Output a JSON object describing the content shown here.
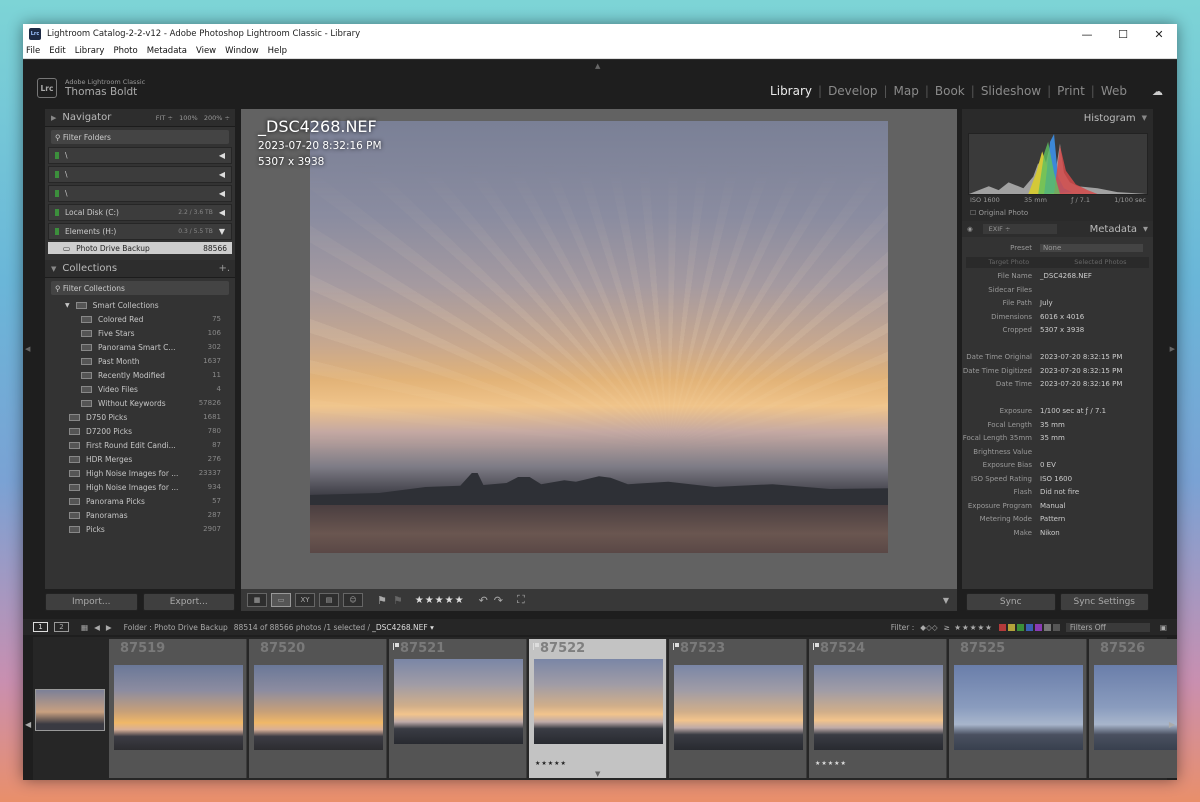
{
  "window": {
    "title": "Lightroom Catalog-2-2-v12 - Adobe Photoshop Lightroom Classic - Library",
    "app_icon": "Lrc"
  },
  "menu": [
    "File",
    "Edit",
    "Library",
    "Photo",
    "Metadata",
    "View",
    "Window",
    "Help"
  ],
  "identity": {
    "logo": "Lrc",
    "product": "Adobe Lightroom Classic",
    "user": "Thomas Boldt"
  },
  "modules": [
    "Library",
    "Develop",
    "Map",
    "Book",
    "Slideshow",
    "Print",
    "Web"
  ],
  "navigator": {
    "title": "Navigator",
    "zooms": [
      "FIT ÷",
      "100%",
      "200% ÷"
    ]
  },
  "folders": {
    "filter": "Filter Folders",
    "volumes": [
      {
        "name": "\\",
        "cap": ""
      },
      {
        "name": "\\",
        "cap": ""
      },
      {
        "name": "\\",
        "cap": ""
      },
      {
        "name": "Local Disk (C:)",
        "cap": "2.2 / 3.6 TB"
      },
      {
        "name": "Elements (H:)",
        "cap": "0.3 / 5.5 TB"
      }
    ],
    "selected": {
      "name": "Photo Drive Backup",
      "count": "88566"
    }
  },
  "collections": {
    "title": "Collections",
    "filter": "Filter Collections",
    "smart": "Smart Collections",
    "items": [
      {
        "name": "Colored Red",
        "count": "75",
        "indent": 2
      },
      {
        "name": "Five Stars",
        "count": "106",
        "indent": 2
      },
      {
        "name": "Panorama Smart C...",
        "count": "302",
        "indent": 2
      },
      {
        "name": "Past Month",
        "count": "1637",
        "indent": 2
      },
      {
        "name": "Recently Modified",
        "count": "11",
        "indent": 2
      },
      {
        "name": "Video Files",
        "count": "4",
        "indent": 2
      },
      {
        "name": "Without Keywords",
        "count": "57826",
        "indent": 2
      },
      {
        "name": "D750 Picks",
        "count": "1681",
        "indent": 1
      },
      {
        "name": "D7200 Picks",
        "count": "780",
        "indent": 1
      },
      {
        "name": "First Round Edit Candi...",
        "count": "87",
        "indent": 1
      },
      {
        "name": "HDR Merges",
        "count": "276",
        "indent": 1
      },
      {
        "name": "High Noise Images for ...",
        "count": "23337",
        "indent": 1
      },
      {
        "name": "High Noise Images for ...",
        "count": "934",
        "indent": 1
      },
      {
        "name": "Panorama Picks",
        "count": "57",
        "indent": 1
      },
      {
        "name": "Panoramas",
        "count": "287",
        "indent": 1
      },
      {
        "name": "Picks",
        "count": "2907",
        "indent": 1
      }
    ]
  },
  "buttons": {
    "import": "Import...",
    "export": "Export...",
    "sync": "Sync",
    "sync_settings": "Sync Settings"
  },
  "photo_info": {
    "filename": "_DSC4268.NEF",
    "datetime": "2023-07-20 8:32:16 PM",
    "dimensions": "5307 x 3938"
  },
  "toolbar": {
    "stars": "★★★★★"
  },
  "histogram": {
    "title": "Histogram",
    "iso": "ISO 1600",
    "focal": "35 mm",
    "aperture": "ƒ / 7.1",
    "shutter": "1/100 sec",
    "original": "Original Photo"
  },
  "metadata": {
    "title": "Metadata",
    "preset_set": "EXIF",
    "preset_label": "Preset",
    "preset_value": "None",
    "target": "Target Photo",
    "selected": "Selected Photos",
    "rows": [
      {
        "k": "File Name",
        "v": "_DSC4268.NEF"
      },
      {
        "k": "Sidecar Files",
        "v": ""
      },
      {
        "k": "File Path",
        "v": "July"
      },
      {
        "k": "Dimensions",
        "v": "6016 x 4016"
      },
      {
        "k": "Cropped",
        "v": "5307 x 3938"
      },
      {
        "k": "",
        "v": ""
      },
      {
        "k": "Date Time Original",
        "v": "2023-07-20 8:32:15 PM"
      },
      {
        "k": "Date Time Digitized",
        "v": "2023-07-20 8:32:15 PM"
      },
      {
        "k": "Date Time",
        "v": "2023-07-20 8:32:16 PM"
      },
      {
        "k": "",
        "v": ""
      },
      {
        "k": "Exposure",
        "v": "1/100 sec at ƒ / 7.1"
      },
      {
        "k": "Focal Length",
        "v": "35 mm"
      },
      {
        "k": "Focal Length 35mm",
        "v": "35 mm"
      },
      {
        "k": "Brightness Value",
        "v": ""
      },
      {
        "k": "Exposure Bias",
        "v": "0 EV"
      },
      {
        "k": "ISO Speed Rating",
        "v": "ISO 1600"
      },
      {
        "k": "Flash",
        "v": "Did not fire"
      },
      {
        "k": "Exposure Program",
        "v": "Manual"
      },
      {
        "k": "Metering Mode",
        "v": "Pattern"
      },
      {
        "k": "Make",
        "v": "Nikon"
      }
    ]
  },
  "filmstrip_bar": {
    "page1": "1",
    "page2": "2",
    "source": "Folder : Photo Drive Backup",
    "count": "88514 of 88566 photos /1 selected /",
    "selected_file": "_DSC4268.NEF ▾",
    "filter_label": "Filter :",
    "filters_off": "Filters Off"
  },
  "filmstrip": [
    {
      "num": "87519",
      "flag": false,
      "stars": ""
    },
    {
      "num": "87520",
      "flag": false,
      "stars": ""
    },
    {
      "num": "87521",
      "flag": true,
      "stars": ""
    },
    {
      "num": "87522",
      "flag": true,
      "stars": "★★★★★",
      "selected": true
    },
    {
      "num": "87523",
      "flag": true,
      "stars": ""
    },
    {
      "num": "87524",
      "flag": true,
      "stars": "★★★★★"
    },
    {
      "num": "87525",
      "flag": false,
      "stars": ""
    },
    {
      "num": "87526",
      "flag": false,
      "stars": ""
    }
  ]
}
